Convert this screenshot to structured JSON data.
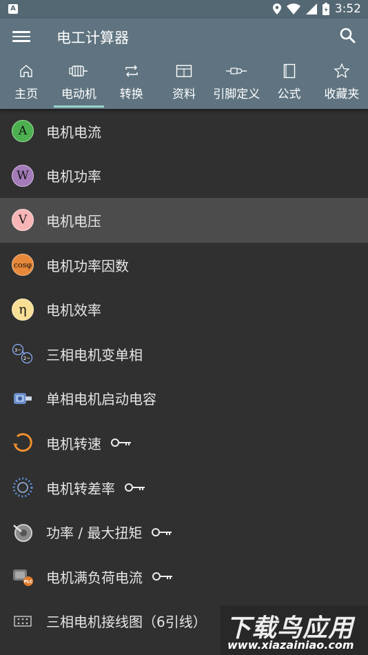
{
  "status_bar": {
    "time": "3:52",
    "notification_icon": "A"
  },
  "app_bar": {
    "title": "电工计算器"
  },
  "tabs": [
    {
      "label": "主页",
      "icon": "home-icon"
    },
    {
      "label": "电动机",
      "icon": "motor-icon",
      "active": true
    },
    {
      "label": "转换",
      "icon": "repeat-icon"
    },
    {
      "label": "资料",
      "icon": "table-icon"
    },
    {
      "label": "引脚定义",
      "icon": "connector-icon"
    },
    {
      "label": "公式",
      "icon": "book-icon"
    },
    {
      "label": "收藏夹",
      "icon": "star-icon"
    }
  ],
  "items": [
    {
      "label": "电机电流",
      "badge": "A",
      "locked": false
    },
    {
      "label": "电机功率",
      "badge": "W",
      "locked": false
    },
    {
      "label": "电机电压",
      "badge": "V",
      "locked": false,
      "selected": true
    },
    {
      "label": "电机功率因数",
      "badge": "cosφ",
      "locked": false
    },
    {
      "label": "电机效率",
      "badge": "η",
      "locked": false
    },
    {
      "label": "三相电机变单相",
      "badge": "3~ 2~",
      "locked": false
    },
    {
      "label": "单相电机启动电容",
      "locked": false
    },
    {
      "label": "电机转速",
      "locked": true
    },
    {
      "label": "电机转差率",
      "locked": true
    },
    {
      "label": "功率 / 最大扭矩",
      "locked": true
    },
    {
      "label": "电机满负荷电流",
      "badge": "PLC",
      "locked": true
    },
    {
      "label": "三相电机接线图（6引线）",
      "locked": false
    }
  ],
  "watermark": {
    "title": "下载鸟应用",
    "url": "www.xiazainiao.com"
  },
  "colors": {
    "app_bar": "#5f7480",
    "status_bar": "#546873",
    "background": "#303030",
    "tab_indicator": "#9ad6ca",
    "selected_row": "#4c4c4c"
  }
}
